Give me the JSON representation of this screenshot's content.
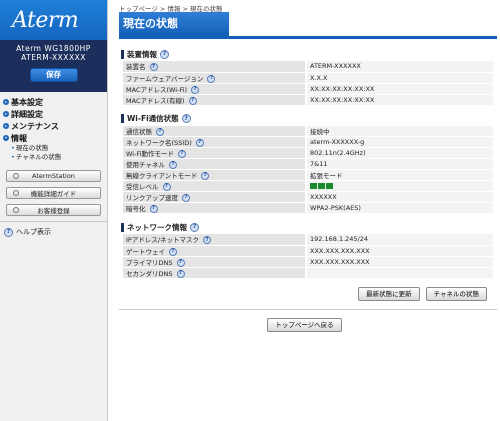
{
  "logo": "Aterm",
  "device": {
    "model": "Aterm WG1800HP",
    "id": "ATERM-XXXXXX",
    "save_label": "保存"
  },
  "menu": {
    "items": [
      {
        "label": "基本設定"
      },
      {
        "label": "詳細設定"
      },
      {
        "label": "メンテナンス"
      },
      {
        "label": "情報"
      }
    ],
    "sub_items": [
      {
        "label": "現在の状態"
      },
      {
        "label": "チャネルの状態"
      }
    ]
  },
  "side_buttons": [
    {
      "label": "AtermStation"
    },
    {
      "label": "機能詳細ガイド"
    },
    {
      "label": "お客様登録"
    }
  ],
  "help_label": "ヘルプ表示",
  "breadcrumb": "トップページ > 情報 > 現在の状態",
  "page_title": "現在の状態",
  "sections": {
    "device_info": {
      "title": "装置情報",
      "rows": [
        {
          "key": "装置名",
          "value": "ATERM-XXXXXX"
        },
        {
          "key": "ファームウェアバージョン",
          "value": "X.X.X"
        },
        {
          "key": "MACアドレス(Wi-Fi)",
          "value": "XX:XX:XX:XX:XX:XX"
        },
        {
          "key": "MACアドレス(有線)",
          "value": "XX:XX:XX:XX:XX:XX"
        }
      ]
    },
    "wifi_status": {
      "title": "Wi-Fi通信状態",
      "rows": [
        {
          "key": "通信状態",
          "value": "接続中"
        },
        {
          "key": "ネットワーク名(SSID)",
          "value": "aterm-XXXXXX-g"
        },
        {
          "key": "Wi-Fi動作モード",
          "value": "802.11n(2.4GHz)"
        },
        {
          "key": "使用チャネル",
          "value": "7&11"
        },
        {
          "key": "無線クライアントモード",
          "value": "拡張モード"
        },
        {
          "key": "受信レベル",
          "value": "",
          "signal_bars": 3,
          "signal_color": "#1a8a2e"
        },
        {
          "key": "リンクアップ速度",
          "value": "XXXXXX"
        },
        {
          "key": "暗号化",
          "value": "WPA2-PSK(AES)"
        }
      ]
    },
    "network_info": {
      "title": "ネットワーク情報",
      "rows": [
        {
          "key": "IPアドレス/ネットマスク",
          "value": "192.168.1.245/24"
        },
        {
          "key": "ゲートウェイ",
          "value": "XXX.XXX.XXX.XXX"
        },
        {
          "key": "プライマリDNS",
          "value": "XXX.XXX.XXX.XXX"
        },
        {
          "key": "セカンダリDNS",
          "value": ""
        }
      ]
    }
  },
  "buttons": {
    "refresh": "最新状態に更新",
    "channel_status": "チャネルの状態",
    "back_top": "トップページへ戻る"
  },
  "colors": {
    "accent": "#1c63bb",
    "sidebar_dark": "#1c2e5c",
    "signal": "#1a8a2e"
  }
}
